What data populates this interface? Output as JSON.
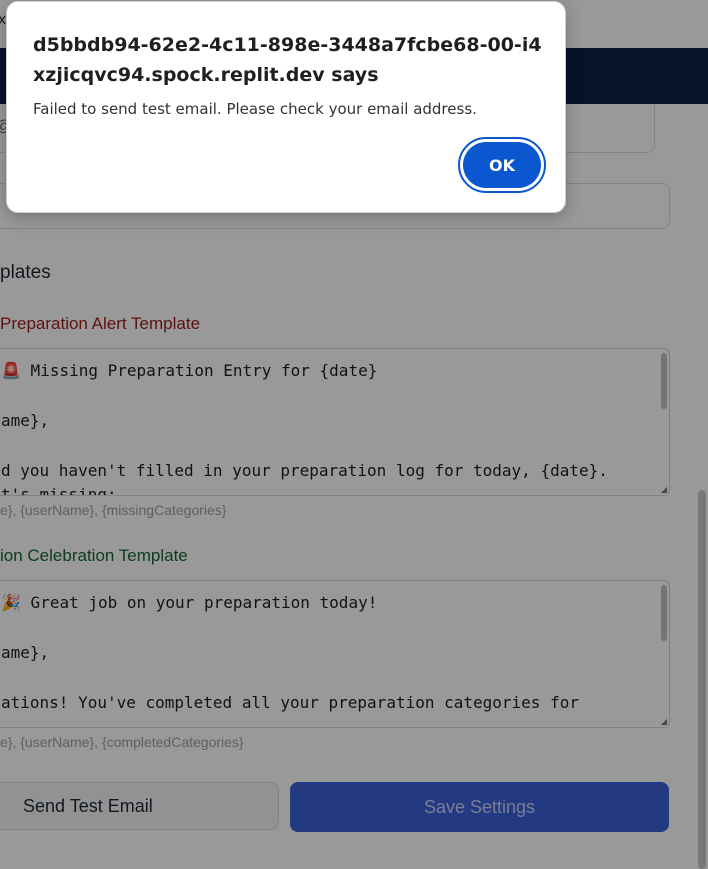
{
  "page": {
    "close_glyph": "x",
    "field_glyph": "@"
  },
  "section": {
    "heading": "plates"
  },
  "templates": [
    {
      "label": "Preparation Alert Template",
      "lines": [
        "🚨 Missing Preparation Entry for {date}",
        "ame},",
        "d you haven't filled in your preparation log for today, {date}.",
        "t's missing:"
      ],
      "variables_hint": "e}, {userName}, {missingCategories}"
    },
    {
      "label": "ion Celebration Template",
      "lines": [
        "🎉 Great job on your preparation today!",
        "ame},",
        "ations! You've completed all your preparation categories for"
      ],
      "variables_hint": "e}, {userName}, {completedCategories}"
    }
  ],
  "actions": {
    "send_test_label": "Send Test Email",
    "save_label": "Save Settings"
  },
  "dialog": {
    "title": "d5bbdb94-62e2-4c11-898e-3448a7fcbe68-00-i4xzjicqvc94.spock.replit.dev says",
    "message": "Failed to send test email. Please check your email address.",
    "ok_label": "OK"
  },
  "colors": {
    "navbar": "#0b2048",
    "alert_label": "#9b1c1c",
    "success_label": "#166534",
    "primary_button": "#3b5fd9",
    "dialog_accent": "#0b57d0"
  }
}
